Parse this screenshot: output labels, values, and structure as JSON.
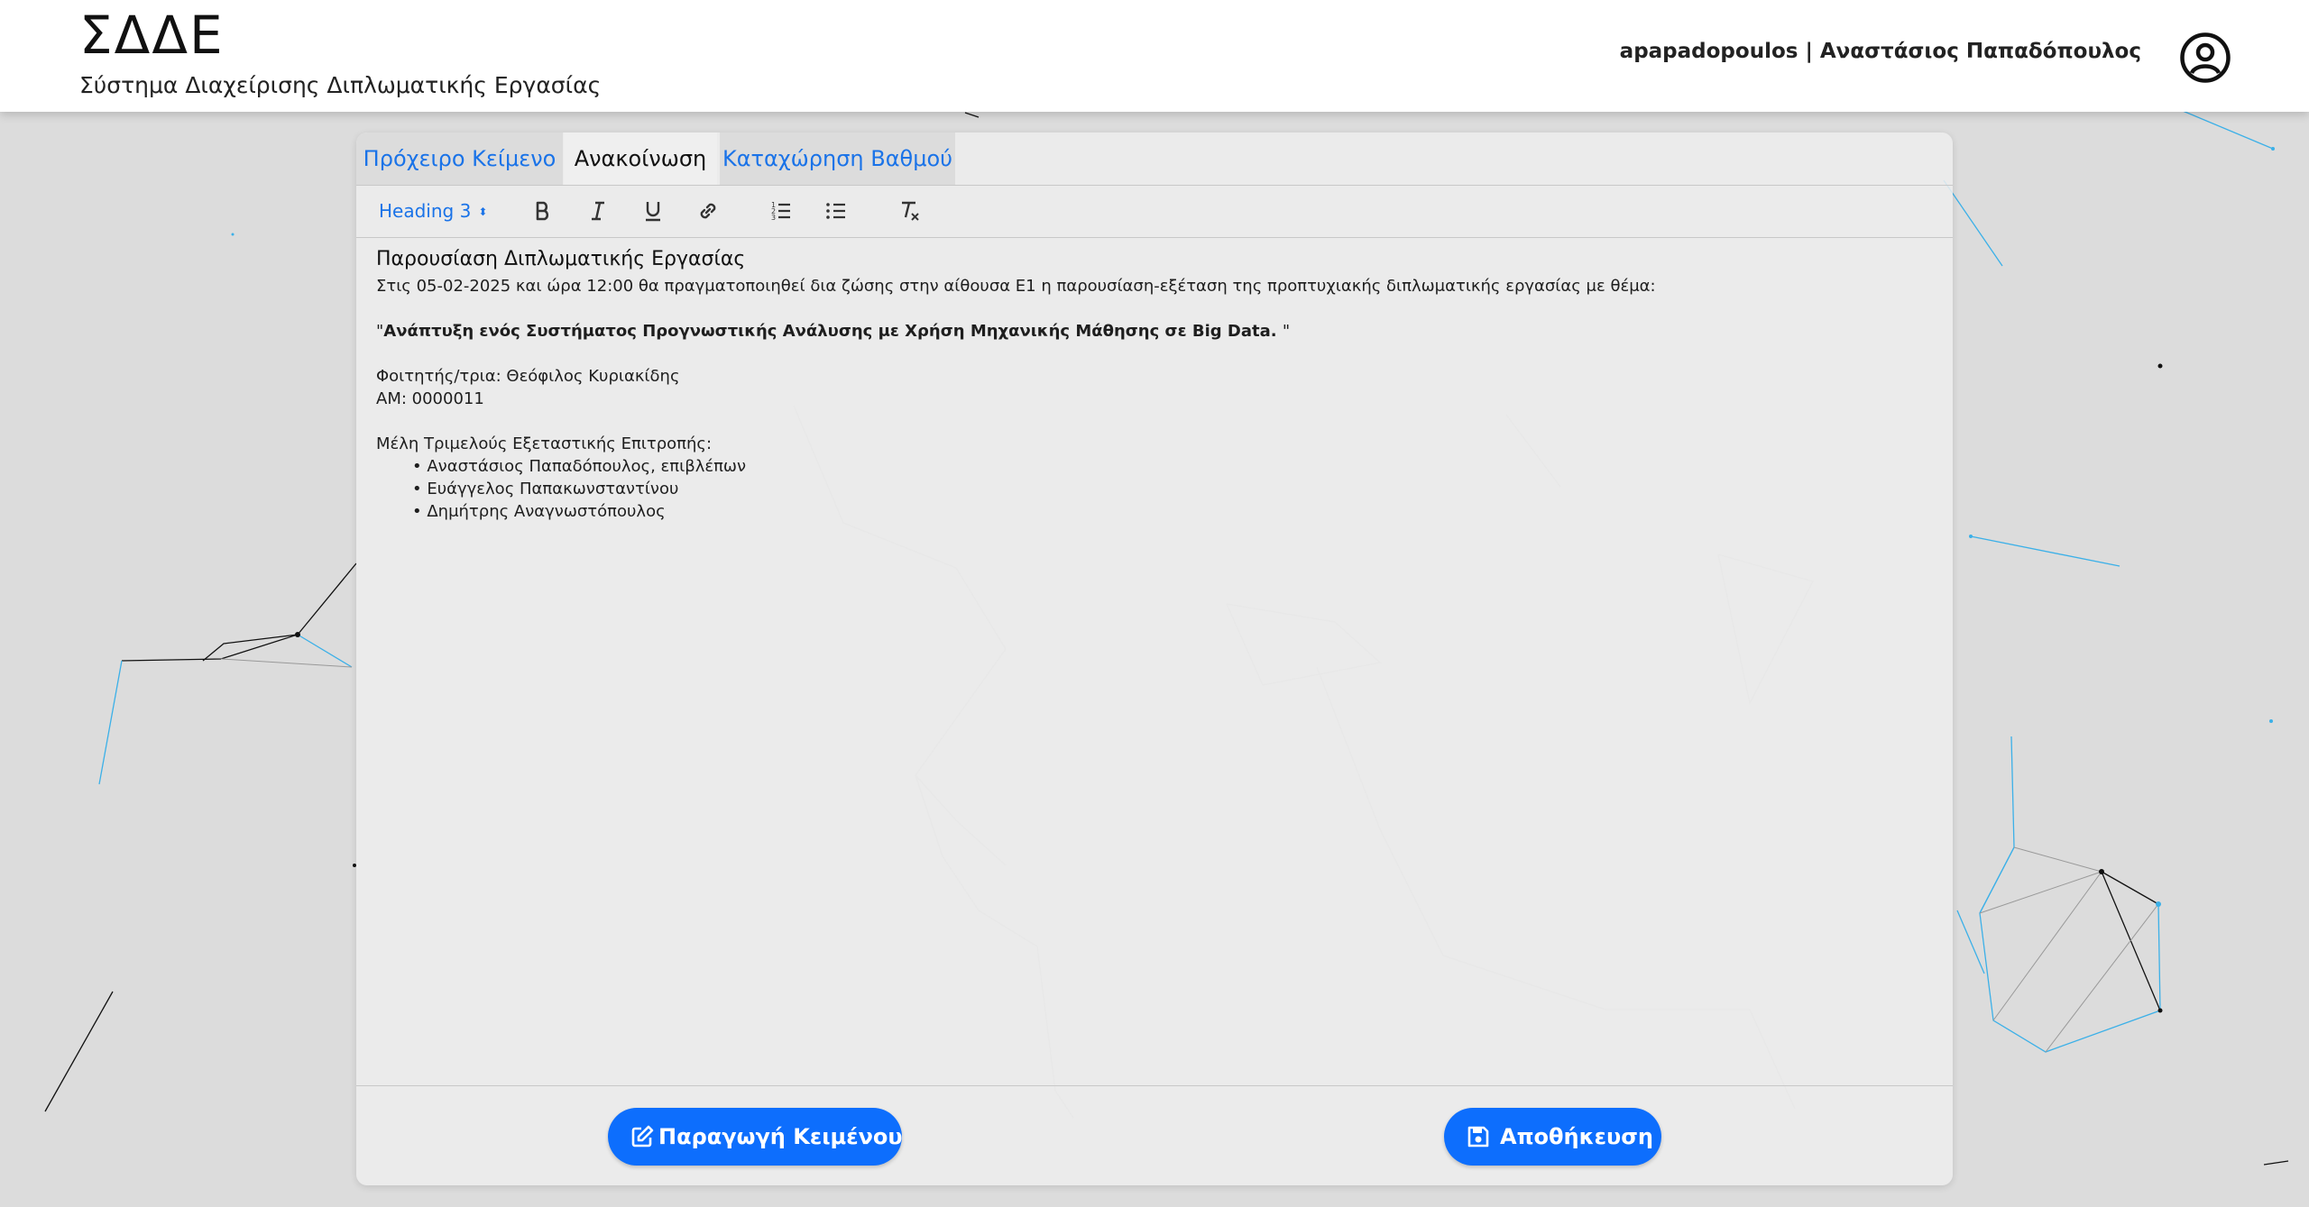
{
  "header": {
    "title": "ΣΔΔΕ",
    "subtitle": "Σύστημα Διαχείρισης Διπλωματικής Εργασίας",
    "user": "apapadopoulos | Αναστάσιος Παπαδόπουλος",
    "avatar_icon": "user-circle-icon"
  },
  "tabs": [
    {
      "label": "Πρόχειρο Κείμενο",
      "active": false
    },
    {
      "label": "Ανακοίνωση",
      "active": true
    },
    {
      "label": "Καταχώρηση Βαθμού",
      "active": false
    }
  ],
  "toolbar": {
    "heading_select": "Heading 3",
    "buttons": [
      "bold-icon",
      "italic-icon",
      "underline-icon",
      "link-icon",
      "ordered-list-icon",
      "bullet-list-icon",
      "clear-format-icon"
    ]
  },
  "editor": {
    "heading": "Παρουσίαση Διπλωματικής Εργασίας",
    "intro": "Στις 05-02-2025 και ώρα 12:00 θα πραγματοποιηθεί δια ζώσης στην αίθουσα Ε1 η παρουσίαση-εξέταση της προπτυχιακής διπλωματικής εργασίας με θέμα:",
    "quote_open": "\"",
    "thesis_title": "Ανάπτυξη ενός Συστήματος Προγνωστικής Ανάλυσης με Χρήση Μηχανικής Μάθησης σε Big Data. ",
    "quote_close": "\"",
    "student": "Φοιτητής/τρια: Θεόφιλος Κυριακίδης",
    "am": "ΑΜ: 0000011",
    "committee_label": "Μέλη Τριμελούς Εξεταστικής Επιτροπής:",
    "committee": [
      "Αναστάσιος Παπαδόπουλος, επιβλέπων",
      "Ευάγγελος Παπακωνσταντίνου",
      "Δημήτρης Αναγνωστόπουλος"
    ]
  },
  "actions": {
    "generate_label": "Παραγωγή Κειμένου",
    "generate_icon": "edit-icon",
    "save_label": "Αποθήκευση",
    "save_icon": "floppy-disk-icon"
  },
  "colors": {
    "accent": "#0d6efd",
    "tab_link": "#1a73e8",
    "background": "#dcdcdc"
  }
}
